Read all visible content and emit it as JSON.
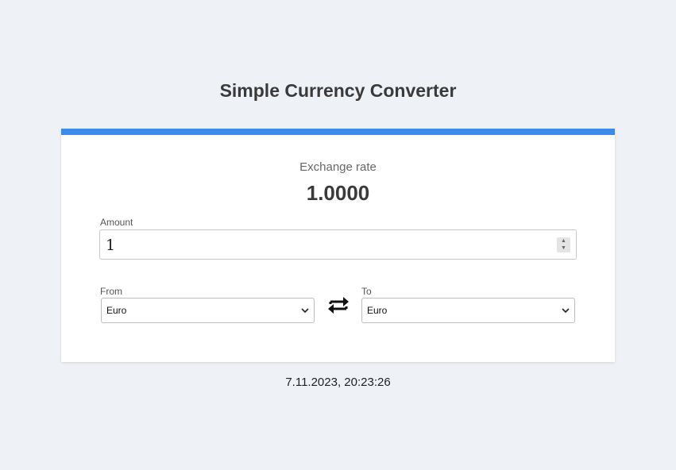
{
  "header": {
    "title": "Simple Currency Converter"
  },
  "converter": {
    "rate_label": "Exchange rate",
    "rate_value": "1.0000",
    "amount_label": "Amount",
    "amount_value": "1",
    "from_label": "From",
    "from_value": "Euro",
    "to_label": "To",
    "to_value": "Euro",
    "swap_icon": "swap-arrows-icon"
  },
  "footer": {
    "timestamp": "7.11.2023, 20:23:26"
  },
  "colors": {
    "accent": "#3b8beb",
    "background": "#eef1f6",
    "card": "#ffffff"
  }
}
